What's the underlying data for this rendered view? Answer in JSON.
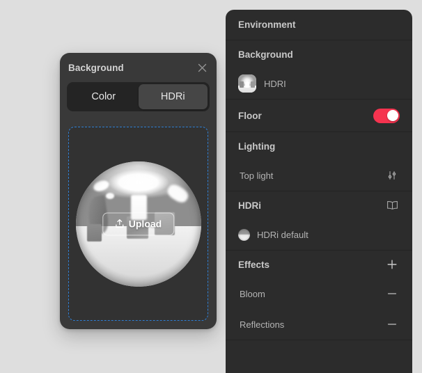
{
  "theme": {
    "page_bg": "#dedede",
    "dialog_bg": "#393939",
    "panel_bg": "#2c2c2c",
    "accent_toggle": "#F5334F",
    "dropzone_border": "#2f7fd4",
    "text_primary": "#d3d3d3",
    "text_secondary": "#b4b4b4"
  },
  "background_dialog": {
    "title": "Background",
    "close_icon": "close-icon",
    "tabs": [
      {
        "label": "Color",
        "selected": false
      },
      {
        "label": "HDRi",
        "selected": true
      }
    ],
    "dropzone": {
      "upload_button_label": "Upload",
      "upload_icon": "upload-icon",
      "preview": "chrome-sphere-hdri-preview"
    }
  },
  "environment_panel": {
    "title": "Environment",
    "sections": [
      {
        "heading": "Background",
        "heading_action_icon": null,
        "rows": [
          {
            "label": "HDRI",
            "thumb": "hdri-studio-thumbnail",
            "control": null
          }
        ]
      },
      {
        "heading": "Floor",
        "heading_control": "toggle",
        "toggle_on": true,
        "rows": []
      },
      {
        "heading": "Lighting",
        "heading_action_icon": null,
        "rows": [
          {
            "label": "Top light",
            "thumb": null,
            "control": "sliders-icon"
          }
        ]
      },
      {
        "heading": "HDRi",
        "heading_action_icon": "book-icon",
        "rows": [
          {
            "label": "HDRi default",
            "thumb": "hdri-sphere-thumbnail",
            "control": null
          }
        ]
      },
      {
        "heading": "Effects",
        "heading_action_icon": "plus-icon",
        "rows": [
          {
            "label": "Bloom",
            "thumb": null,
            "control": "minus-icon"
          },
          {
            "label": "Reflections",
            "thumb": null,
            "control": "minus-icon"
          }
        ]
      }
    ]
  }
}
